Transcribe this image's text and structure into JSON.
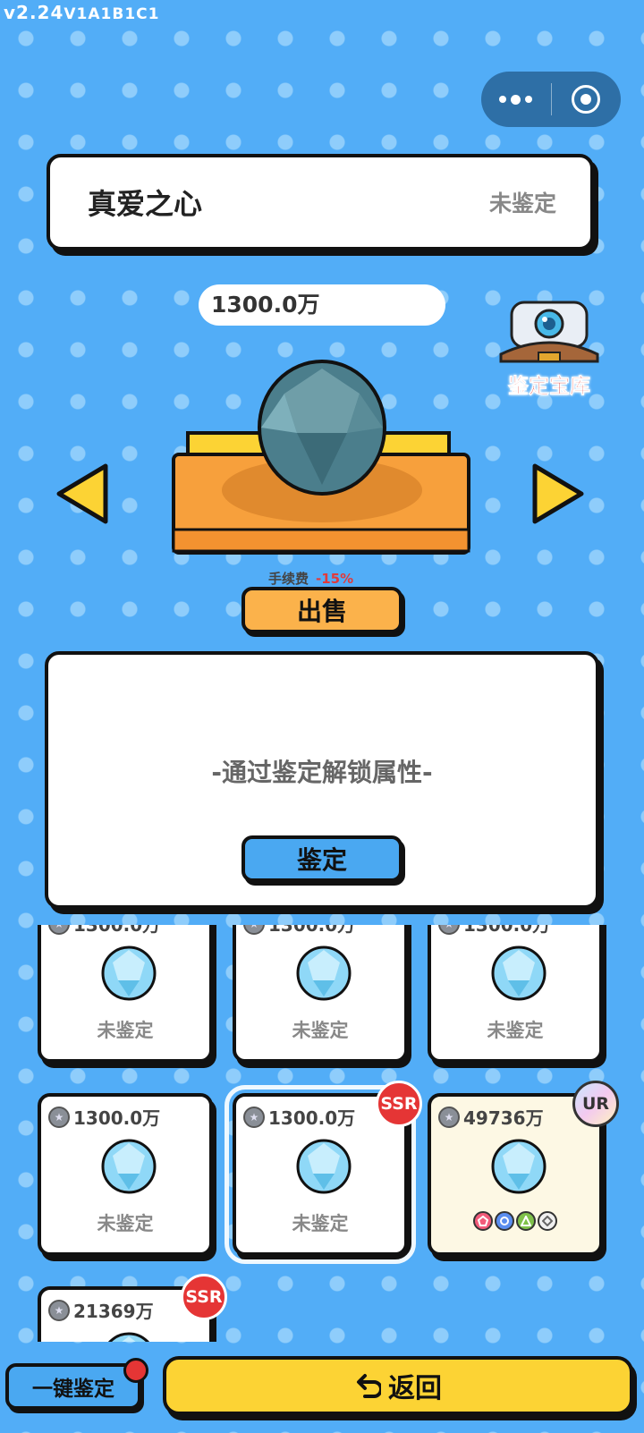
{
  "app": {
    "version": "v2.24",
    "build": "V1A1B1C1"
  },
  "item": {
    "name": "真爱之心",
    "status": "未鉴定",
    "price": "1300.0万"
  },
  "vault": {
    "label": "鉴定宝库"
  },
  "fee": {
    "label": "手续费",
    "value": "-15%"
  },
  "actions": {
    "sell": "出售",
    "appraise": "鉴定",
    "one_key": "一键鉴定",
    "back": "返回"
  },
  "info": {
    "hint": "-通过鉴定解锁属性-"
  },
  "colors": {
    "background": "#52adf7",
    "panel": "#ffffff",
    "sell": "#fbb24b",
    "appraise": "#4aa8f1",
    "back": "#fcd334",
    "ssr": "#e53535"
  },
  "cards": [
    {
      "price": "1300.0万",
      "status": "未鉴定",
      "rarity": ""
    },
    {
      "price": "1300.0万",
      "status": "未鉴定",
      "rarity": ""
    },
    {
      "price": "1300.0万",
      "status": "未鉴定",
      "rarity": ""
    },
    {
      "price": "1300.0万",
      "status": "未鉴定",
      "rarity": ""
    },
    {
      "price": "1300.0万",
      "status": "未鉴定",
      "rarity": "SSR",
      "selected": true
    },
    {
      "price": "49736万",
      "status": "",
      "rarity": "UR",
      "attributes": [
        "pentagon-icon",
        "circle-icon",
        "triangle-icon",
        "diamond-icon"
      ]
    },
    {
      "price": "21369万",
      "status": "",
      "rarity": "SSR"
    }
  ]
}
